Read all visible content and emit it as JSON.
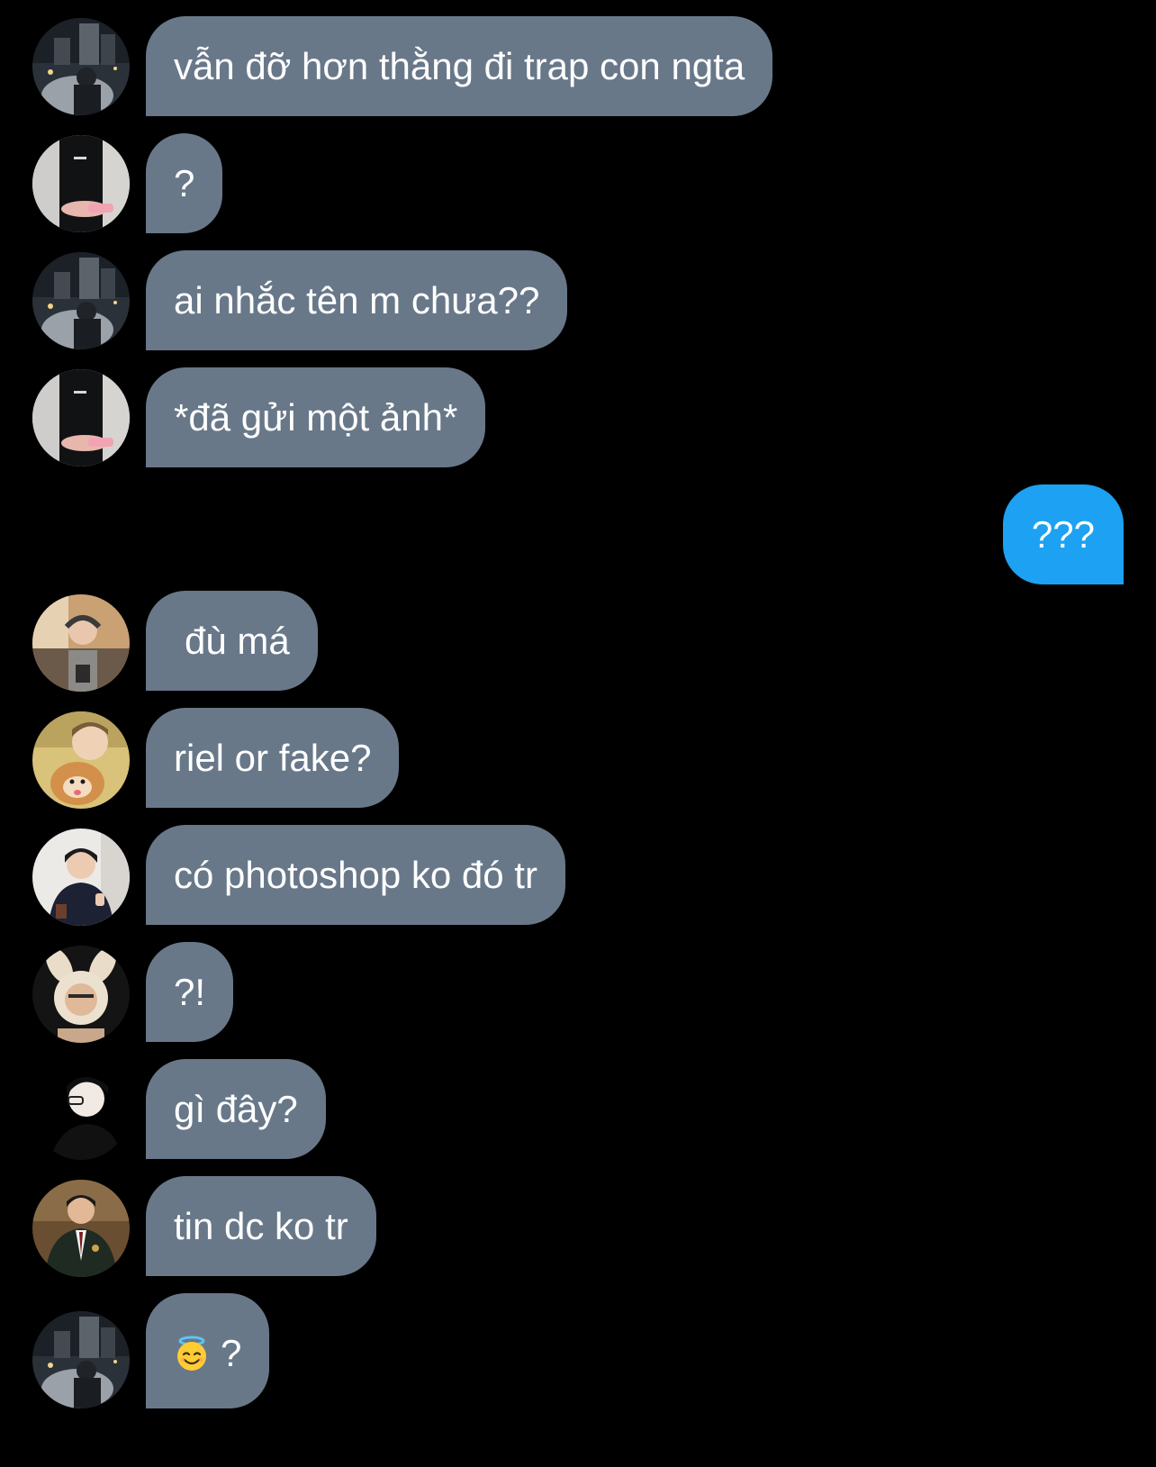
{
  "conversation": {
    "messages": [
      {
        "sender": "incoming",
        "text": "vẫn đỡ hơn thằng đi trap con ngta"
      },
      {
        "sender": "incoming",
        "text": "?"
      },
      {
        "sender": "incoming",
        "text": "ai nhắc tên m chưa??"
      },
      {
        "sender": "incoming",
        "text": "*đã gửi một ảnh*"
      },
      {
        "sender": "outgoing",
        "text": "???"
      },
      {
        "sender": "incoming",
        "text": "đù má"
      },
      {
        "sender": "incoming",
        "text": "riel or fake?"
      },
      {
        "sender": "incoming",
        "text": "có photoshop ko đó tr"
      },
      {
        "sender": "incoming",
        "text": "?!"
      },
      {
        "sender": "incoming",
        "text": "gì đây?"
      },
      {
        "sender": "incoming",
        "text": "tin dc ko tr"
      },
      {
        "sender": "incoming",
        "text": "?",
        "emoji": "smiling-face-with-halo-icon"
      }
    ]
  },
  "colors": {
    "background": "#000000",
    "incoming_bubble": "#687889",
    "outgoing_bubble": "#1da1f2",
    "text": "#ffffff"
  }
}
